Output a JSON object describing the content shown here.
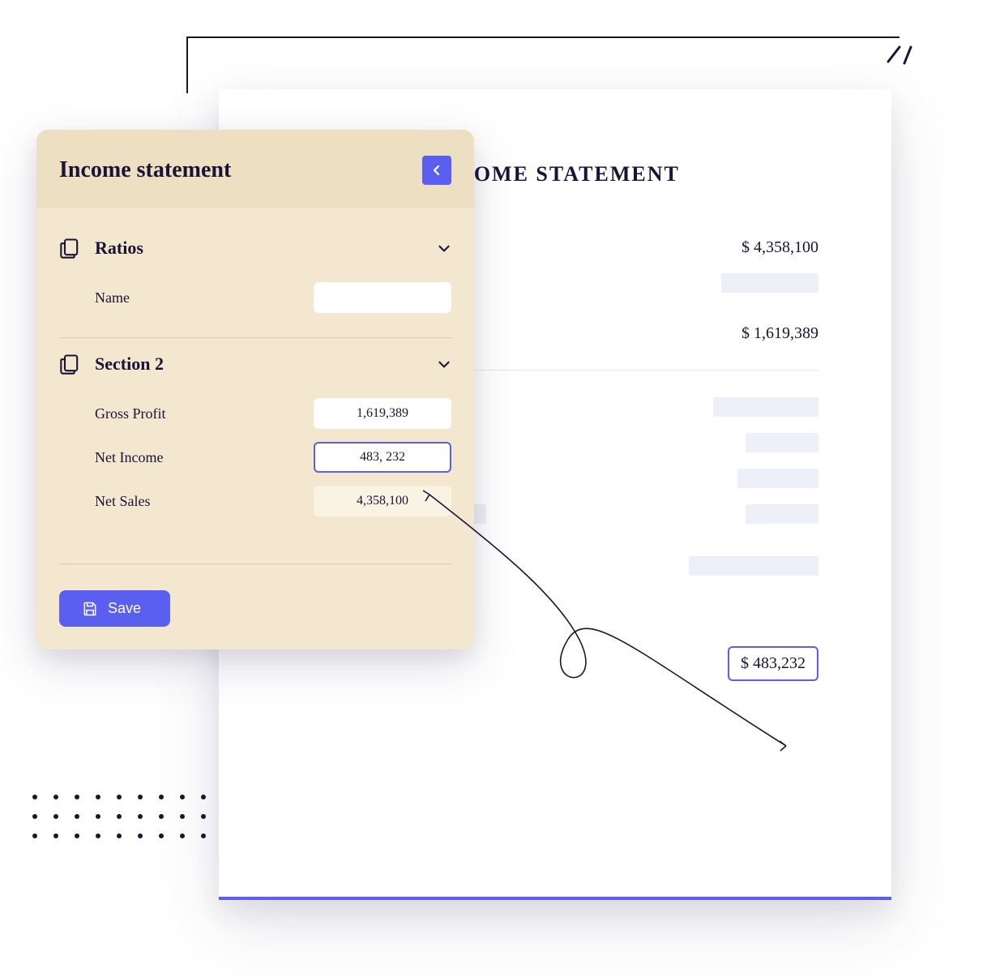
{
  "panel": {
    "title": "Income statement",
    "sections": [
      {
        "title": "Ratios",
        "fields": [
          {
            "label": "Name",
            "value": ""
          }
        ]
      },
      {
        "title": "Section 2",
        "fields": [
          {
            "label": "Gross Profit",
            "value": "1,619,389"
          },
          {
            "label": "Net Income",
            "value": "483, 232"
          },
          {
            "label": "Net Sales",
            "value": "4,358,100"
          }
        ]
      }
    ],
    "save_label": "Save"
  },
  "document": {
    "title": "INCOME STATEMENT",
    "lines": {
      "line1_value": "$ 4,358,100",
      "line2_value": "$ 1,619,389",
      "highlight_value": "$ 483,232"
    }
  },
  "colors": {
    "accent": "#5b5ff0",
    "panel_bg": "#f3e7cf",
    "panel_header_bg": "#eddfc1",
    "text": "#1a1336"
  }
}
